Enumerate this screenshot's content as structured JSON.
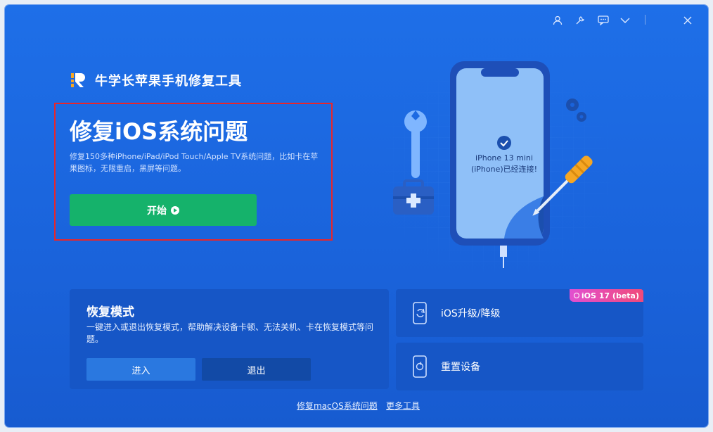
{
  "app": {
    "name": "牛学长苹果手机修复工具"
  },
  "titlebar": {
    "icons": [
      "user-icon",
      "wrench-icon",
      "feedback-icon",
      "chevron-down-icon",
      "close-icon"
    ]
  },
  "hero": {
    "title": "修复iOS系统问题",
    "description": "修复150多种iPhone/iPad/iPod Touch/Apple TV系统问题，比如卡在苹果图标，无限重启，黑屏等问题。",
    "start_label": "开始"
  },
  "device": {
    "line1": "iPhone 13 mini",
    "line2": "(iPhone)已经连接!"
  },
  "recovery": {
    "title": "恢复模式",
    "description": "一键进入或退出恢复模式，帮助解决设备卡顿、无法关机、卡在恢复模式等问题。",
    "enter_label": "进入",
    "exit_label": "退出"
  },
  "upgrade": {
    "label": "iOS升级/降级",
    "badge": "iOS 17 (beta)"
  },
  "reset": {
    "label": "重置设备"
  },
  "footer": {
    "macos_link": "修复macOS系统问题",
    "more_link": "更多工具"
  },
  "colors": {
    "background": "#1a63db",
    "start_button": "#15b26b",
    "highlight_border": "#e8262b",
    "badge": "#e24fd0"
  }
}
